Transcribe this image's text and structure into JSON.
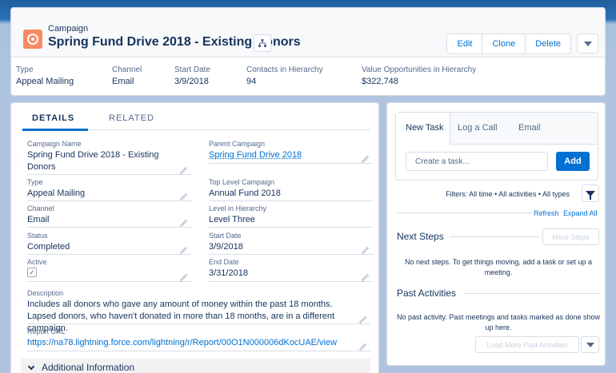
{
  "header": {
    "object_type": "Campaign",
    "record_title": "Spring Fund Drive 2018 - Existing Donors",
    "actions": {
      "edit": "Edit",
      "clone": "Clone",
      "delete": "Delete"
    },
    "highlights": [
      {
        "label": "Type",
        "value": "Appeal Mailing"
      },
      {
        "label": "Channel",
        "value": "Email"
      },
      {
        "label": "Start Date",
        "value": "3/9/2018"
      },
      {
        "label": "Contacts in Hierarchy",
        "value": "94"
      },
      {
        "label": "Value Opportunities in Hierarchy",
        "value": "$322,748"
      }
    ]
  },
  "tabs": {
    "details": "DETAILS",
    "related": "RELATED"
  },
  "details": {
    "campaign_name": {
      "label": "Campaign Name",
      "value": "Spring Fund Drive 2018 - Existing Donors"
    },
    "parent_campaign": {
      "label": "Parent Campaign",
      "value": "Spring Fund Drive 2018"
    },
    "type": {
      "label": "Type",
      "value": "Appeal Mailing"
    },
    "top_level_campaign": {
      "label": "Top Level Campaign",
      "value": "Annual Fund 2018"
    },
    "channel": {
      "label": "Channel",
      "value": "Email"
    },
    "level_in_hierarchy": {
      "label": "Level in Hierarchy",
      "value": "Level Three"
    },
    "status": {
      "label": "Status",
      "value": "Completed"
    },
    "start_date": {
      "label": "Start Date",
      "value": "3/9/2018"
    },
    "active": {
      "label": "Active",
      "checked": true
    },
    "end_date": {
      "label": "End Date",
      "value": "3/31/2018"
    },
    "description": {
      "label": "Description",
      "value": "Includes all donors who gave any amount of money within the past 18 months. Lapsed donors, who haven't donated in more than 18 months, are in a different campaign."
    },
    "report_url": {
      "label": "Report URL",
      "value": "https://na78.lightning.force.com/lightning/r/Report/00O1N000006dKocUAE/view"
    }
  },
  "additional_info": "Additional Information",
  "activity": {
    "publisher_tabs": [
      "New Task",
      "Log a Call",
      "Email"
    ],
    "task_placeholder": "Create a task...",
    "add_label": "Add",
    "filters_text": "Filters: All time • All activities • All types",
    "refresh": "Refresh",
    "expand_all": "Expand All",
    "next_steps_title": "Next Steps",
    "more_steps": "More Steps",
    "next_steps_empty": "No next steps. To get things moving, add a task or set up a meeting.",
    "past_title": "Past Activities",
    "past_empty": "No past activity. Past meetings and tasks marked as done show up here.",
    "load_more": "Load More Past Activities"
  },
  "colors": {
    "accent": "#0070d2",
    "campaign_icon": "#f88962",
    "text": "#16325c"
  }
}
